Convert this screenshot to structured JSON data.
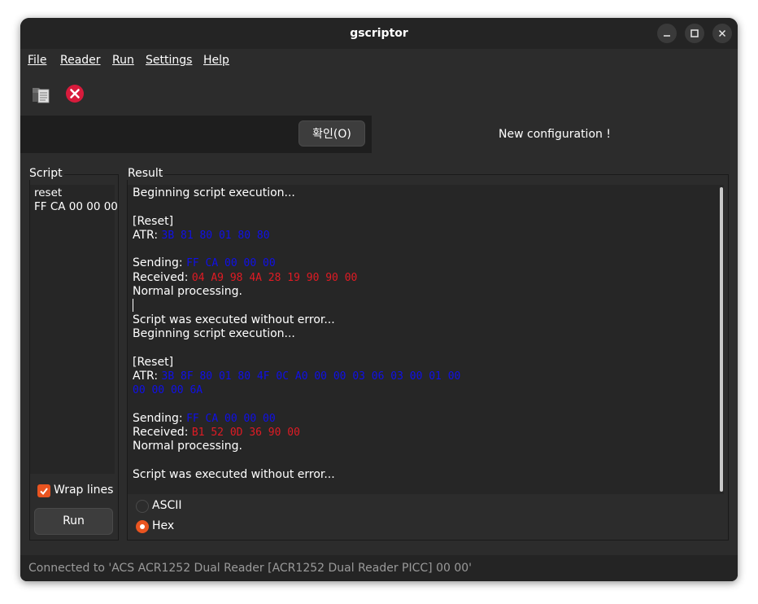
{
  "window": {
    "title": "gscriptor"
  },
  "menu": {
    "items": [
      {
        "label": "File"
      },
      {
        "label": "Reader"
      },
      {
        "label": "Run"
      },
      {
        "label": "Settings"
      },
      {
        "label": "Help"
      }
    ]
  },
  "toolbar": {
    "open_icon": "folder-document-icon",
    "stop_icon": "red-close-icon"
  },
  "infobar": {
    "ok_label": "확인(O)",
    "message": "New configuration !"
  },
  "script_panel": {
    "label": "Script",
    "content": "reset\nFF CA 00 00 00",
    "wrap_lines_label": "Wrap lines",
    "wrap_lines_checked": true,
    "run_label": "Run"
  },
  "result_panel": {
    "label": "Result",
    "lines": {
      "l1": "Beginning script execution...",
      "l3": "[Reset]",
      "l4_label": "ATR: ",
      "l4_value": "3B 81 80 01 80 80",
      "l6_label": "Sending: ",
      "l6_value": "FF CA 00 00 00",
      "l7_label": "Received: ",
      "l7_value": "04 A9 98 4A 28 19 90 90 00",
      "l8": "Normal processing.",
      "l10": "Script was executed without error...",
      "l11": "Beginning script execution...",
      "l13": "[Reset]",
      "l14_label": "ATR: ",
      "l14_value": "3B 8F 80 01 80 4F 0C A0 00 00 03 06 03 00 01 00",
      "l15_value": "00 00 00 6A",
      "l17_label": "Sending: ",
      "l17_value": "FF CA 00 00 00",
      "l18_label": "Received: ",
      "l18_value": "B1 52 0D 36 90 00",
      "l19": "Normal processing.",
      "l21": "Script was executed without error..."
    },
    "mode_ascii_label": "ASCII",
    "mode_hex_label": "Hex",
    "selected_mode": "Hex"
  },
  "statusbar": {
    "text": "Connected to 'ACS ACR1252 Dual Reader [ACR1252 Dual Reader PICC] 00 00'"
  },
  "colors": {
    "accent": "#e95420",
    "hex_blue": "#1010e8",
    "hex_red": "#e01b24"
  }
}
